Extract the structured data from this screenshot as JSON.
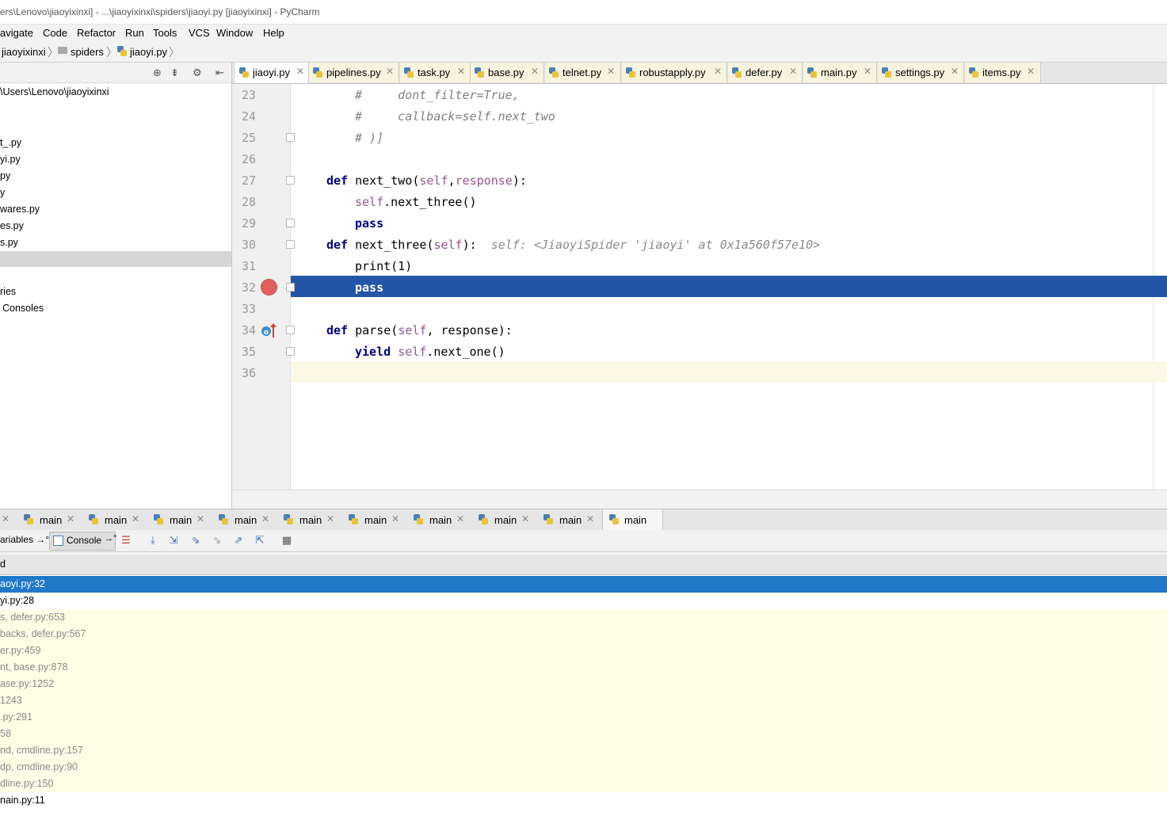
{
  "window": {
    "title": "ers\\Lenovo\\jiaoyixinxi] - ...\\jiaoyixinxi\\spiders\\jiaoyi.py [jiaoyixinxi] - PyCharm"
  },
  "menu": [
    "avigate",
    "Code",
    "Refactor",
    "Run",
    "Tools",
    "VCS",
    "Window",
    "Help"
  ],
  "breadcrumb": [
    "jiaoyixinxi",
    "spiders",
    "jiaoyi.py"
  ],
  "project": {
    "root_path": "\\Users\\Lenovo\\jiaoyixinxi",
    "items": [
      "t_.py",
      "yi.py",
      "py",
      "y",
      "wares.py",
      "es.py",
      "s.py",
      "",
      "ries",
      "Consoles"
    ]
  },
  "editor_tabs": [
    {
      "label": "jiaoyi.py",
      "active": true
    },
    {
      "label": "pipelines.py"
    },
    {
      "label": "task.py"
    },
    {
      "label": "base.py"
    },
    {
      "label": "telnet.py"
    },
    {
      "label": "robustapply.py"
    },
    {
      "label": "defer.py"
    },
    {
      "label": "main.py"
    },
    {
      "label": "settings.py"
    },
    {
      "label": "items.py"
    }
  ],
  "code": {
    "line_numbers": [
      "23",
      "24",
      "25",
      "26",
      "27",
      "28",
      "29",
      "30",
      "31",
      "32",
      "33",
      "34",
      "35",
      "36"
    ],
    "l23": "#     dont_filter=True,",
    "l24": "#     callback=self.next_two",
    "l25": "# )]",
    "l27_kw": "def",
    "l27_name": "next_two",
    "l27_self": "self",
    "l27_p2": "response",
    "l27_end": "):",
    "l28_self": "self",
    "l28_rest": ".next_three()",
    "l29_kw": "pass",
    "l30_kw": "def",
    "l30_name": "next_three",
    "l30_self": "self",
    "l30_end": "):",
    "l30_hint": "self: <JiaoyiSpider 'jiaoyi' at 0x1a560f57e10>",
    "l31": "print(1)",
    "l32_kw": "pass",
    "l34_kw": "def",
    "l34_name": "parse",
    "l34_self": "self",
    "l34_rest": ", response):",
    "l35_kw": "yield",
    "l35_self": "self",
    "l35_rest": ".next_one()"
  },
  "thread_tabs": [
    "main",
    "main",
    "main",
    "main",
    "main",
    "main",
    "main",
    "main",
    "main",
    "main"
  ],
  "debug_toolbar": {
    "variables_label": "ariables",
    "console_label": "Console"
  },
  "frames_header": "d",
  "frames": [
    {
      "text": "aoyi.py:32",
      "kind": "sel"
    },
    {
      "text": "yi.py:28",
      "kind": "user"
    },
    {
      "text": "s, defer.py:653",
      "kind": "lib"
    },
    {
      "text": "backs, defer.py:567",
      "kind": "lib"
    },
    {
      "text": "er.py:459",
      "kind": "lib"
    },
    {
      "text": "nt, base.py:878",
      "kind": "lib"
    },
    {
      "text": "ase.py:1252",
      "kind": "lib"
    },
    {
      "text": "1243",
      "kind": "lib"
    },
    {
      "text": ".py:291",
      "kind": "lib"
    },
    {
      "text": "58",
      "kind": "lib"
    },
    {
      "text": "nd, cmdline.py:157",
      "kind": "lib"
    },
    {
      "text": "dp, cmdline.py:90",
      "kind": "lib"
    },
    {
      "text": "dline.py:150",
      "kind": "lib"
    },
    {
      "text": "nain.py:11",
      "kind": "user"
    }
  ],
  "colors": {
    "execution_line": "#2456a8",
    "frame_selected": "#1f78c8",
    "library_frame_bg": "#fefee6",
    "tab_bg": "#f7f3de"
  },
  "icons": [
    "breakpoint-icon",
    "override-method-icon",
    "python-file-icon",
    "folder-icon"
  ]
}
